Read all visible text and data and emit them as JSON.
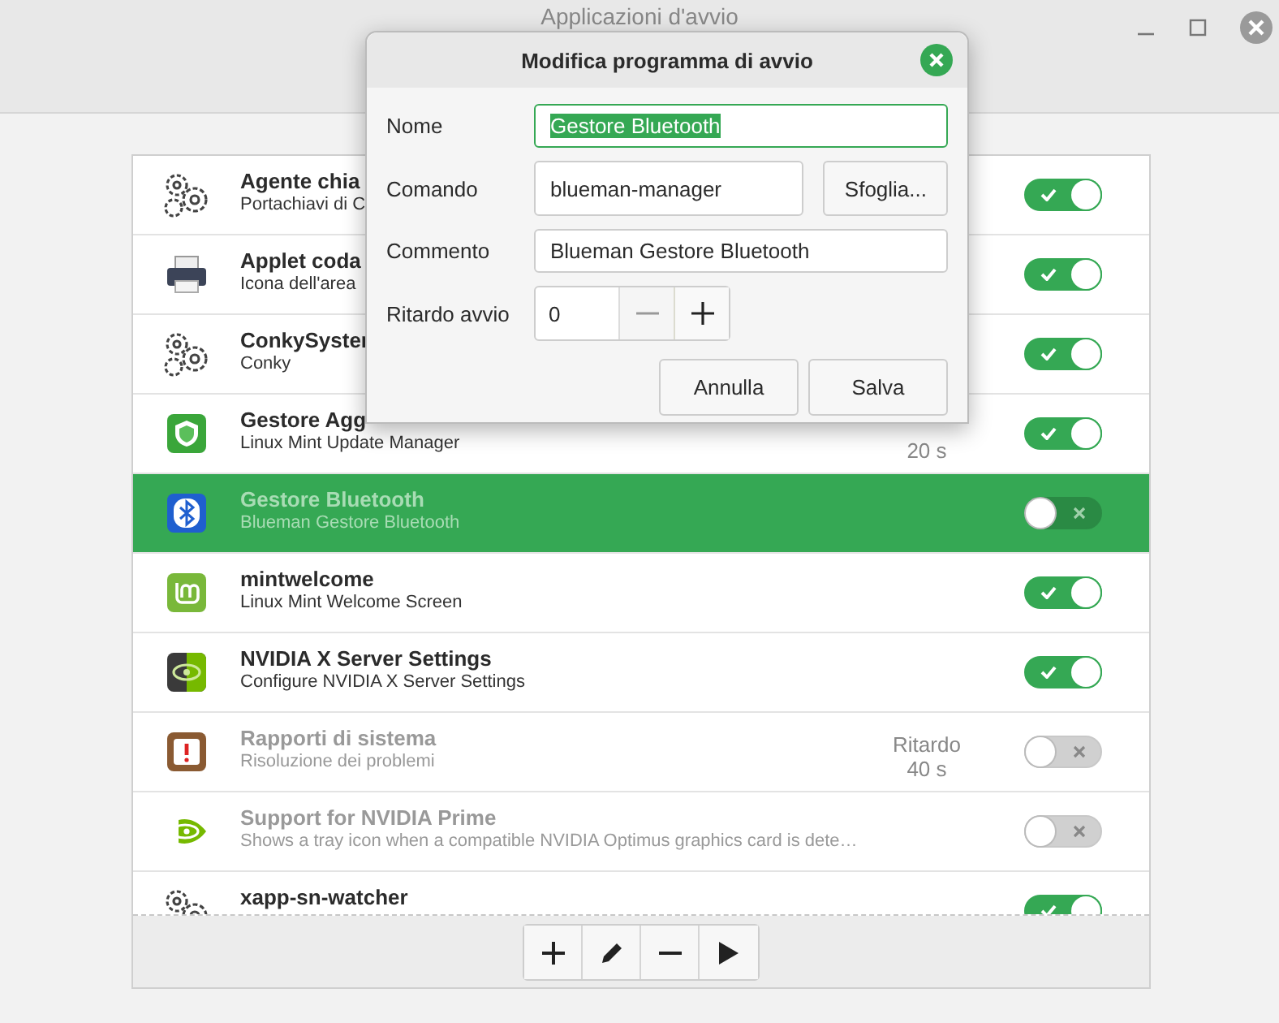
{
  "window": {
    "title": "Applicazioni d'avvio"
  },
  "rows": [
    {
      "kind": "gears",
      "name": "Agente chia",
      "description": "Portachiavi di C",
      "enabled": true,
      "selected": false
    },
    {
      "kind": "printer",
      "name": "Applet coda",
      "description": "Icona dell'area",
      "enabled": true,
      "selected": false
    },
    {
      "kind": "gears",
      "name": "ConkySyster",
      "description": "Conky",
      "enabled": true,
      "selected": false
    },
    {
      "kind": "shield",
      "name": "Gestore Agg",
      "description": "Linux Mint Update Manager",
      "delay": "20 s",
      "enabled": true,
      "selected": false
    },
    {
      "kind": "bluetooth",
      "name": "Gestore Bluetooth",
      "description": "Blueman Gestore Bluetooth",
      "enabled": false,
      "selected": true
    },
    {
      "kind": "mint",
      "name": "mintwelcome",
      "description": "Linux Mint Welcome Screen",
      "enabled": true,
      "selected": false
    },
    {
      "kind": "nvidia-box",
      "name": "NVIDIA X Server Settings",
      "description": "Configure NVIDIA X Server Settings",
      "enabled": true,
      "selected": false
    },
    {
      "kind": "report",
      "name": "Rapporti di sistema",
      "description": "Risoluzione dei problemi",
      "delay_label": "Ritardo",
      "delay": "40 s",
      "enabled": false,
      "selected": false
    },
    {
      "kind": "nvidia",
      "name": "Support for NVIDIA Prime",
      "description": "Shows a tray icon when a compatible NVIDIA Optimus graphics card is dete…",
      "enabled": false,
      "selected": false
    },
    {
      "kind": "gears",
      "name": "xapp-sn-watcher",
      "enabled": true,
      "selected": false
    }
  ],
  "dialog": {
    "title": "Modifica programma di avvio",
    "name_label": "Nome",
    "name_value": "Gestore Bluetooth",
    "command_label": "Comando",
    "command_value": "blueman-manager",
    "browse_button": "Sfoglia...",
    "comment_label": "Commento",
    "comment_value": "Blueman Gestore Bluetooth",
    "delay_label": "Ritardo avvio",
    "delay_value": "0",
    "buttons": [
      "Annulla",
      "Salva"
    ]
  }
}
